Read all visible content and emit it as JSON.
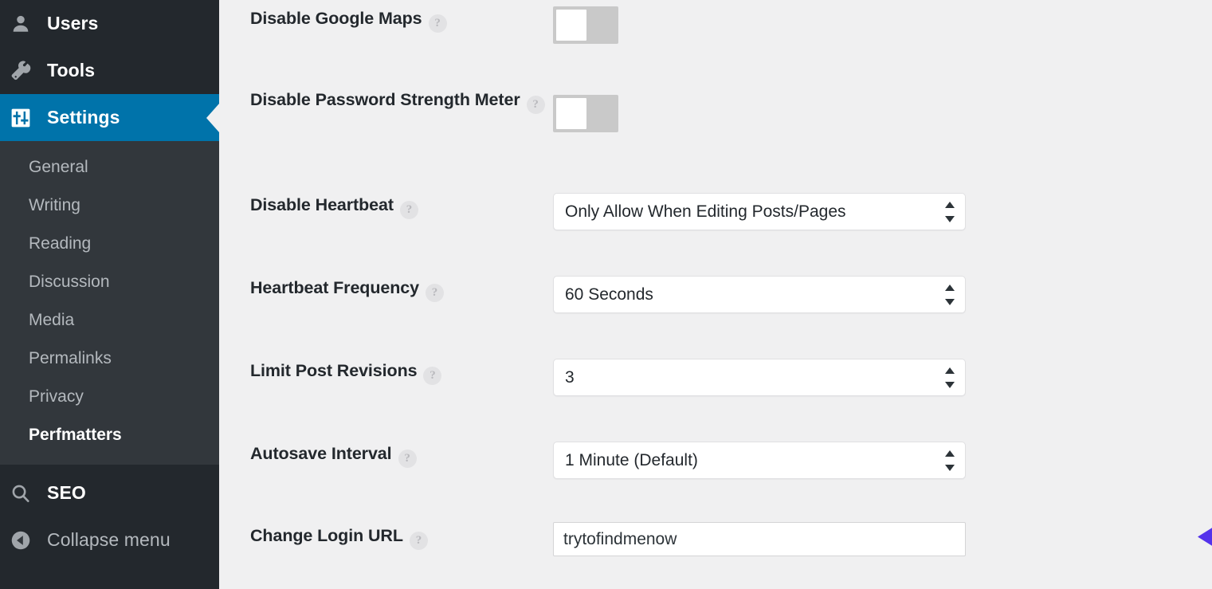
{
  "sidebar": {
    "top_items": [
      {
        "label": "Users",
        "icon": "user-icon",
        "current": false
      },
      {
        "label": "Tools",
        "icon": "wrench-icon",
        "current": false
      },
      {
        "label": "Settings",
        "icon": "settings-sliders-icon",
        "current": true
      }
    ],
    "submenu_items": [
      {
        "label": "General",
        "active": false
      },
      {
        "label": "Writing",
        "active": false
      },
      {
        "label": "Reading",
        "active": false
      },
      {
        "label": "Discussion",
        "active": false
      },
      {
        "label": "Media",
        "active": false
      },
      {
        "label": "Permalinks",
        "active": false
      },
      {
        "label": "Privacy",
        "active": false
      },
      {
        "label": "Perfmatters",
        "active": true
      }
    ],
    "bottom_items": [
      {
        "label": "SEO",
        "icon": "search-icon"
      },
      {
        "label": "Collapse menu",
        "icon": "collapse-left-icon"
      }
    ],
    "colors": {
      "background": "#23282d",
      "submenu_background": "#32373c",
      "current_highlight": "#0073aa",
      "text": "#b4b9be"
    }
  },
  "settings": {
    "help_glyph": "?",
    "rows": [
      {
        "label": "Disable Google Maps",
        "control": "toggle",
        "toggle_state": "off"
      },
      {
        "label": "Disable Password Strength Meter",
        "control": "toggle",
        "toggle_state": "off"
      },
      {
        "label": "Disable Heartbeat",
        "control": "select",
        "value": "Only Allow When Editing Posts/Pages"
      },
      {
        "label": "Heartbeat Frequency",
        "control": "select",
        "value": "60 Seconds"
      },
      {
        "label": "Limit Post Revisions",
        "control": "select",
        "value": "3"
      },
      {
        "label": "Autosave Interval",
        "control": "select",
        "value": "1 Minute (Default)"
      },
      {
        "label": "Change Login URL",
        "control": "text",
        "value": "trytofindmenow"
      }
    ]
  },
  "annotation": {
    "type": "arrow-left",
    "color": "#5433EB"
  },
  "theme": {
    "content_background": "#f0f0f1",
    "label_color": "#23282d"
  }
}
